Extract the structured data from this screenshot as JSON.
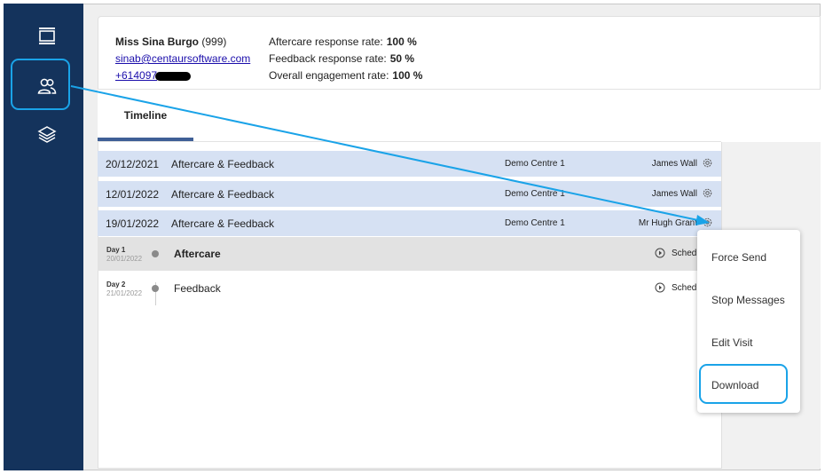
{
  "sidebar": {
    "items": [
      {
        "icon": "window-icon",
        "active": false
      },
      {
        "icon": "users-icon",
        "active": true
      },
      {
        "icon": "layers-icon",
        "active": false
      }
    ]
  },
  "patient": {
    "name": "Miss Sina Burgo",
    "id": "(999)",
    "email": "sinab@centaursoftware.com",
    "phone": "+614097"
  },
  "rates": [
    {
      "label": "Aftercare response rate:",
      "value": "100 %"
    },
    {
      "label": "Feedback response rate:",
      "value": "50 %"
    },
    {
      "label": "Overall engagement rate:",
      "value": "100 %"
    }
  ],
  "tabs": [
    {
      "label": "Timeline",
      "active": true
    }
  ],
  "visits": [
    {
      "date": "20/12/2021",
      "type": "Aftercare & Feedback",
      "centre": "Demo Centre 1",
      "staff": "James Wall"
    },
    {
      "date": "12/01/2022",
      "type": "Aftercare & Feedback",
      "centre": "Demo Centre 1",
      "staff": "James Wall"
    },
    {
      "date": "19/01/2022",
      "type": "Aftercare & Feedback",
      "centre": "Demo Centre 1",
      "staff": "Mr Hugh Grant"
    }
  ],
  "days": [
    {
      "day": "Day 1",
      "date": "20/01/2022",
      "message": "Aftercare",
      "status": "Sched"
    },
    {
      "day": "Day 2",
      "date": "21/01/2022",
      "message": "Feedback",
      "status": "Sched"
    }
  ],
  "menu": {
    "items": [
      "Force Send",
      "Stop Messages",
      "Edit Visit",
      "Download"
    ]
  },
  "colors": {
    "sidebar": "#14335c",
    "highlight": "#1aa3e8",
    "visit_row": "#d6e1f3",
    "tab_accent": "#3f5f96"
  }
}
